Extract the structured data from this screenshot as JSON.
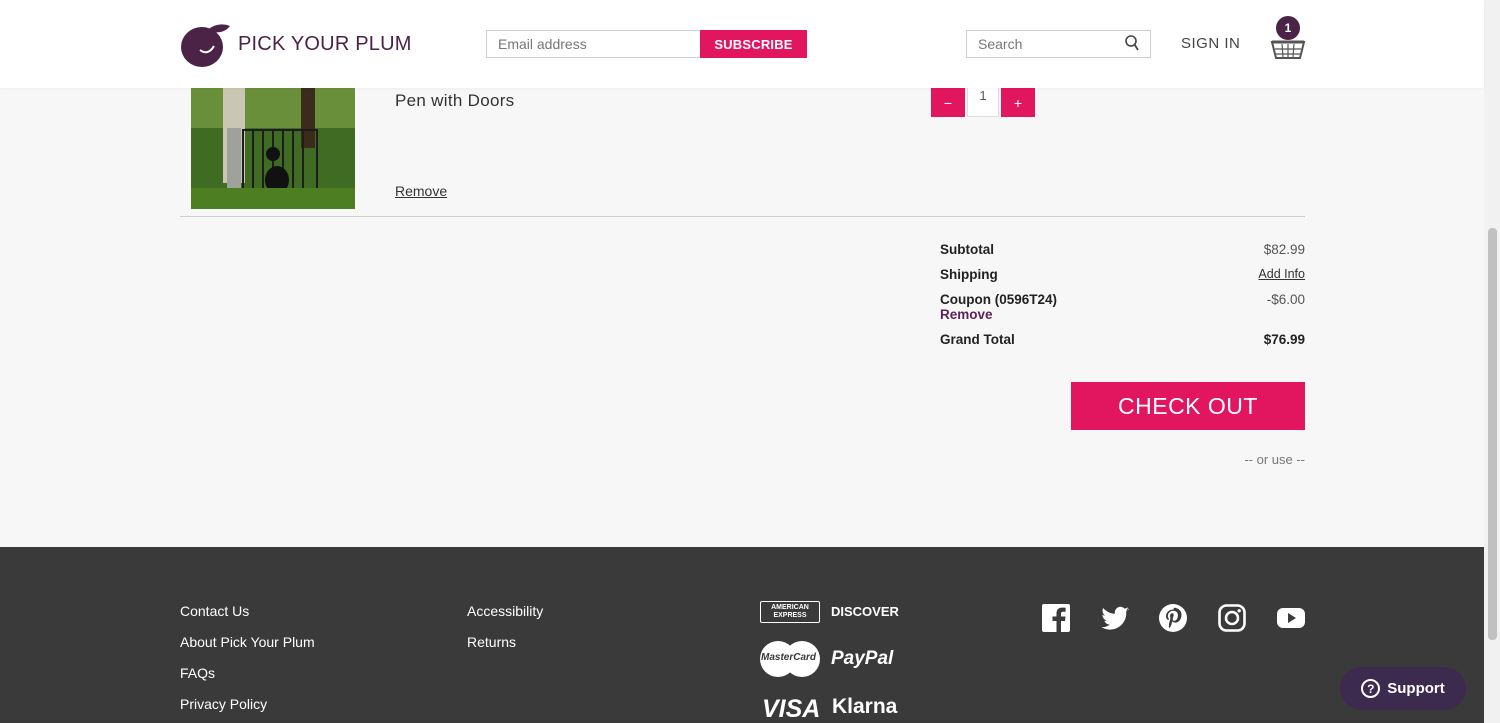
{
  "header": {
    "brand_name": "PICK YOUR PLUM",
    "subscribe": {
      "placeholder": "Email address",
      "button_label": "SUBSCRIBE"
    },
    "search": {
      "placeholder": "Search"
    },
    "signin_label": "SIGN IN",
    "cart_count": "1"
  },
  "cart_item": {
    "title_visible": "Pen with Doors",
    "remove_label": "Remove",
    "quantity": "1",
    "qty_minus": "−",
    "qty_plus": "+"
  },
  "totals": {
    "subtotal_label": "Subtotal",
    "subtotal_value": "$82.99",
    "shipping_label": "Shipping",
    "shipping_link": "Add Info",
    "coupon_label": "Coupon (0596T24)",
    "coupon_value": "-$6.00",
    "coupon_remove": "Remove",
    "grand_total_label": "Grand Total",
    "grand_total_value": "$76.99",
    "checkout_label": "CHECK OUT",
    "or_use": "-- or use --"
  },
  "footer": {
    "col1": [
      "Contact Us",
      "About Pick Your Plum",
      "FAQs",
      "Privacy Policy"
    ],
    "col2": [
      "Accessibility",
      "Returns"
    ],
    "payments": [
      "AMERICAN EXPRESS",
      "DISCOVER",
      "MasterCard",
      "PayPal",
      "VISA",
      "Klarna"
    ],
    "social_icons": [
      "facebook-icon",
      "twitter-icon",
      "pinterest-icon",
      "instagram-icon",
      "youtube-icon"
    ]
  },
  "support": {
    "label": "Support",
    "icon_glyph": "?"
  },
  "colors": {
    "accent": "#e2165f",
    "brand": "#4a2347",
    "footer_bg": "#3a3a3a"
  }
}
